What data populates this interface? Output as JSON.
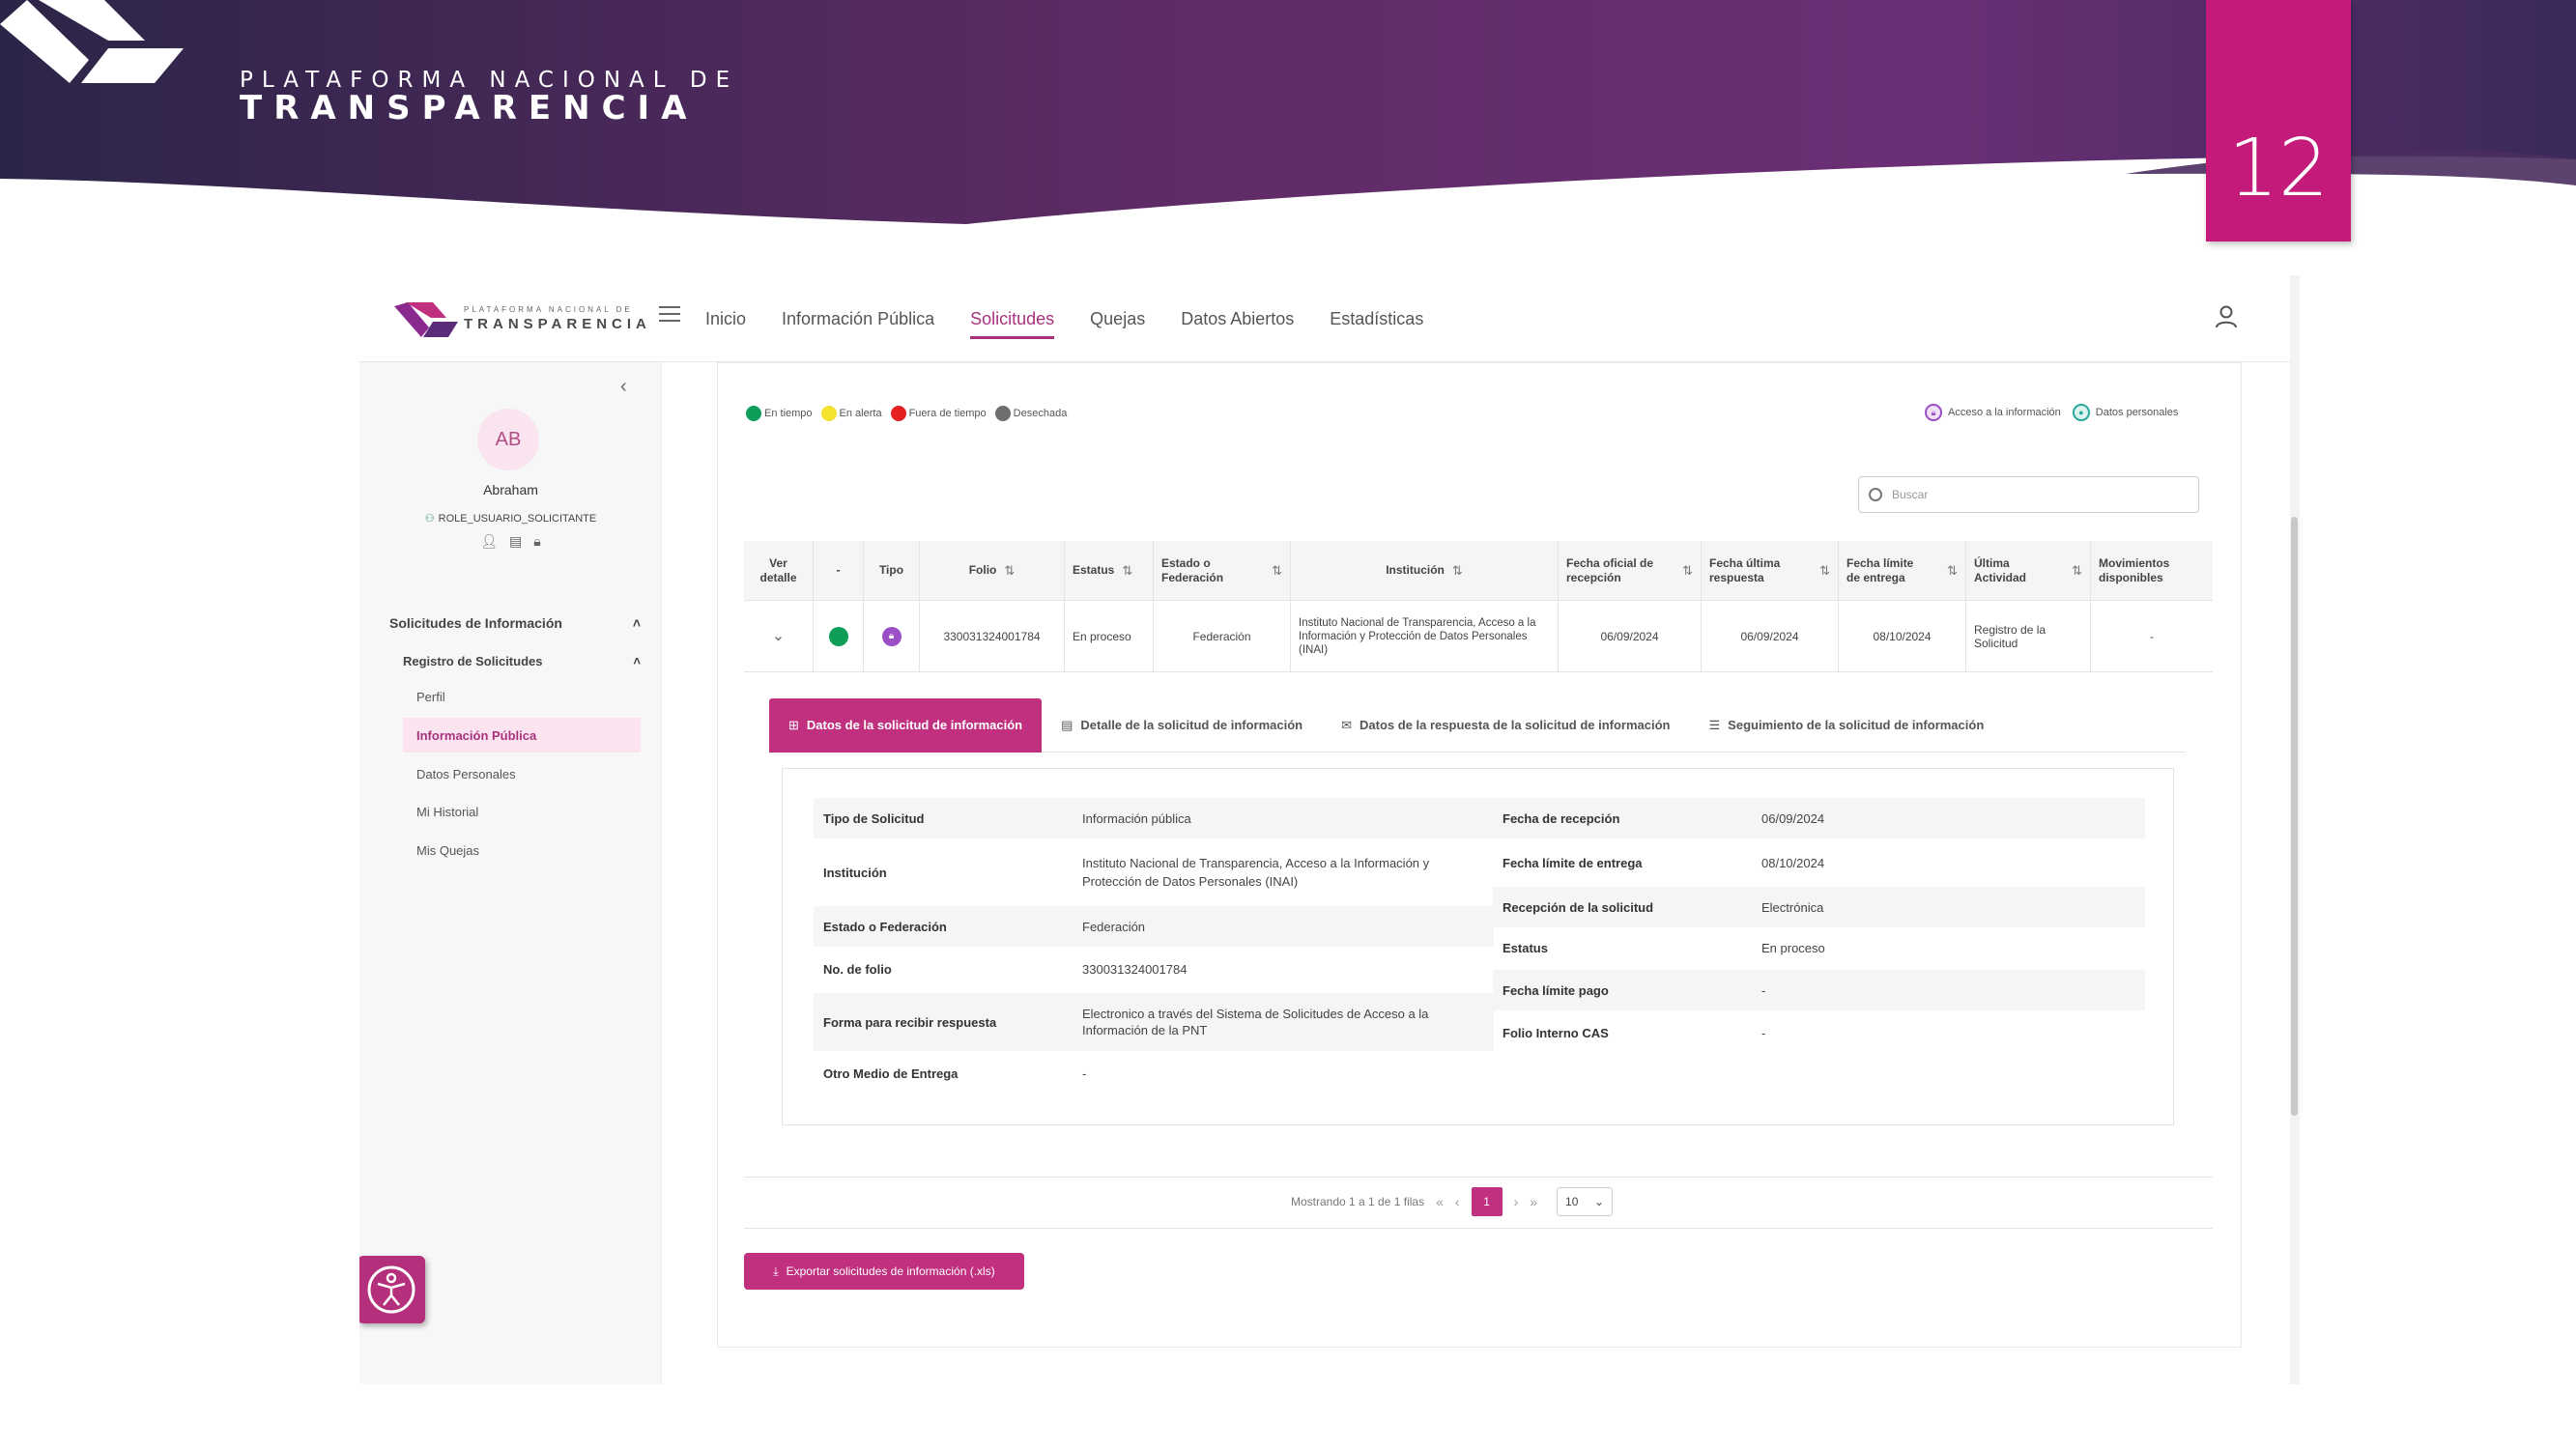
{
  "slide": {
    "logo_top": "PLATAFORMA NACIONAL DE",
    "logo_bottom": "TRANSPARENCIA",
    "page_number": "12",
    "colors": {
      "header_dark": "#2b2346",
      "header_mid": "#6a2d6e",
      "accent": "#c41a7a"
    }
  },
  "app": {
    "logo_top": "PLATAFORMA NACIONAL DE",
    "logo_bottom": "TRANSPARENCIA",
    "nav": [
      "Inicio",
      "Información Pública",
      "Solicitudes",
      "Quejas",
      "Datos Abiertos",
      "Estadísticas"
    ],
    "nav_active": "Solicitudes",
    "sidebar": {
      "avatar_initials": "AB",
      "user_name": "Abraham",
      "user_role": "ROLE_USUARIO_SOLICITANTE",
      "section": "Solicitudes de Información",
      "subsection": "Registro de Solicitudes",
      "items": [
        "Perfil",
        "Información Pública",
        "Datos Personales",
        "Mi Historial",
        "Mis Quejas"
      ],
      "active_item": "Información Pública"
    },
    "legend": {
      "status": [
        {
          "label": "En tiempo",
          "color": "#0f9d58"
        },
        {
          "label": "En alerta",
          "color": "#f4e32c"
        },
        {
          "label": "Fuera de tiempo",
          "color": "#e52020"
        },
        {
          "label": "Desechada",
          "color": "#6e6e6e"
        }
      ],
      "type": [
        {
          "label": "Acceso a la información",
          "color": "#9b4fc4"
        },
        {
          "label": "Datos personales",
          "color": "#2aa79b"
        }
      ]
    },
    "search_placeholder": "Buscar",
    "table": {
      "headers": {
        "ver": "Ver detalle",
        "dash": "-",
        "tipo": "Tipo",
        "folio": "Folio",
        "estatus": "Estatus",
        "estado": "Estado o Federación",
        "institucion": "Institución",
        "fecha_recepcion": "Fecha oficial de recepción",
        "fecha_respuesta": "Fecha última respuesta",
        "fecha_limite": "Fecha límite de entrega",
        "actividad": "Última Actividad",
        "movimientos": "Movimientos disponibles"
      },
      "row": {
        "folio": "330031324001784",
        "estatus": "En proceso",
        "estado": "Federación",
        "institucion": "Instituto Nacional de Transparencia, Acceso a la Información y Protección de Datos Personales (INAI)",
        "fecha_recepcion": "06/09/2024",
        "fecha_respuesta": "06/09/2024",
        "fecha_limite": "08/10/2024",
        "actividad": "Registro de la Solicitud",
        "movimientos": "-"
      }
    },
    "tabs": [
      "Datos de la solicitud de información",
      "Detalle de la solicitud de información",
      "Datos de la respuesta de la solicitud de información",
      "Seguimiento de la solicitud de información"
    ],
    "detail_left": [
      {
        "k": "Tipo de Solicitud",
        "v": "Información pública"
      },
      {
        "k": "Institución",
        "v": "Instituto Nacional de Transparencia, Acceso a la Información y Protección de Datos Personales (INAI)"
      },
      {
        "k": "Estado o Federación",
        "v": "Federación"
      },
      {
        "k": "No. de folio",
        "v": "330031324001784"
      },
      {
        "k": "Forma para recibir respuesta",
        "v": "Electronico a través del Sistema de Solicitudes de Acceso a la Información de la PNT"
      },
      {
        "k": "Otro Medio de Entrega",
        "v": "-"
      }
    ],
    "detail_right": [
      {
        "k": "Fecha de recepción",
        "v": "06/09/2024"
      },
      {
        "k": "Fecha límite de entrega",
        "v": "08/10/2024"
      },
      {
        "k": "Recepción de la solicitud",
        "v": "Electrónica"
      },
      {
        "k": "Estatus",
        "v": "En proceso"
      },
      {
        "k": "Fecha límite pago",
        "v": "-"
      },
      {
        "k": "Folio Interno CAS",
        "v": "-"
      }
    ],
    "pager": {
      "summary": "Mostrando 1 a 1 de 1 filas",
      "current": "1",
      "page_size": "10"
    },
    "export_label": "Exportar solicitudes de información (.xls)"
  }
}
